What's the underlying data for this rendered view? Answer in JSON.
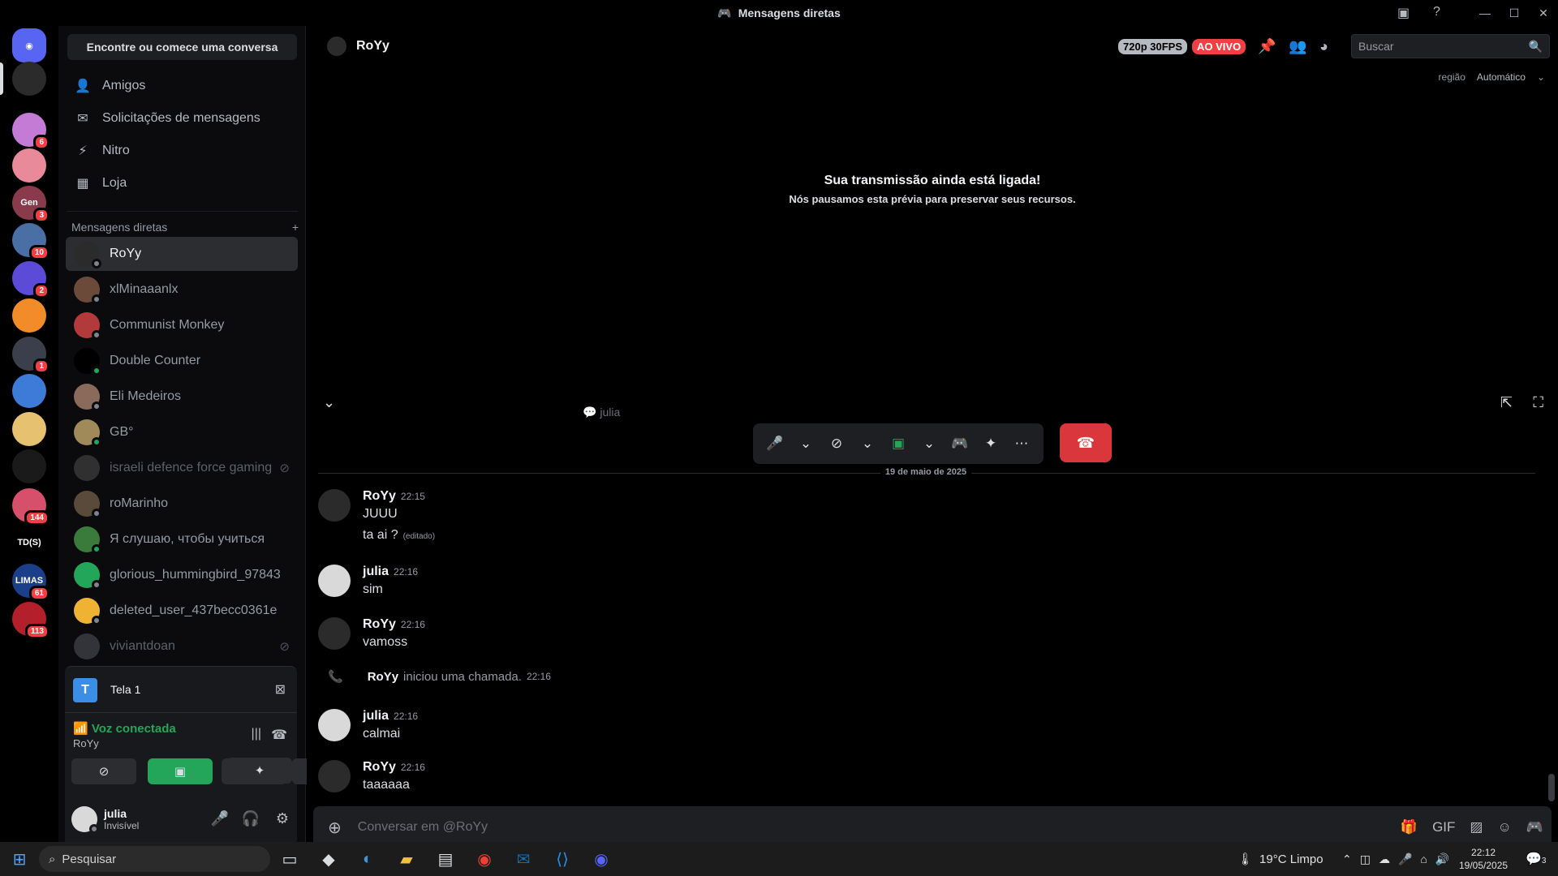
{
  "window": {
    "title": "Mensagens diretas"
  },
  "servers": [
    {
      "label": "",
      "badge": "6",
      "color": "#c47bd6"
    },
    {
      "label": "",
      "badge": "",
      "color": "#e88a9a"
    },
    {
      "label": "Gen",
      "badge": "3",
      "color": "#8a3b4b"
    },
    {
      "label": "",
      "badge": "10",
      "color": "#4a6fa5"
    },
    {
      "label": "",
      "badge": "2",
      "color": "#5b4bd6"
    },
    {
      "label": "",
      "badge": "",
      "color": "#f28c28"
    },
    {
      "label": "",
      "badge": "1",
      "color": "#3a3f4b"
    },
    {
      "label": "",
      "badge": "",
      "color": "#3d7bd9"
    },
    {
      "label": "",
      "badge": "",
      "color": "#e6c170"
    },
    {
      "label": "",
      "badge": "",
      "color": "#1a1a1a"
    },
    {
      "label": "",
      "badge": "144",
      "color": "#d64f6b"
    },
    {
      "label": "TD(S)",
      "badge": "",
      "color": "#000000"
    },
    {
      "label": "LIMAS",
      "badge": "61",
      "color": "#1c3f8a"
    },
    {
      "label": "",
      "badge": "113",
      "color": "#b3202b"
    }
  ],
  "sidebar": {
    "find_label": "Encontre ou comece uma conversa",
    "nav": [
      {
        "label": "Amigos"
      },
      {
        "label": "Solicitações de mensagens"
      },
      {
        "label": "Nitro"
      },
      {
        "label": "Loja"
      }
    ],
    "dm_header": "Mensagens diretas",
    "dms": [
      {
        "name": "RoYy",
        "color": "#2b2b2b"
      },
      {
        "name": "xlMinaaanlx",
        "color": "#6b4a3a"
      },
      {
        "name": "Communist Monkey",
        "color": "#b33a3a"
      },
      {
        "name": "Double Counter",
        "color": "#000000"
      },
      {
        "name": "Eli Medeiros",
        "color": "#8a6a5a"
      },
      {
        "name": "GB°",
        "color": "#a08a5a"
      },
      {
        "name": "israeli defence force gaming",
        "color": "#4a4a4a"
      },
      {
        "name": "roMarinho",
        "color": "#5a4a3a"
      },
      {
        "name": "Я слушаю, чтобы учиться",
        "color": "#3a7a3a"
      },
      {
        "name": "glorious_hummingbird_97843",
        "color": "#23a55a"
      },
      {
        "name": "deleted_user_437becc0361e",
        "color": "#f0b232"
      },
      {
        "name": "viviantdoan",
        "color": "#4e5058"
      }
    ]
  },
  "voice": {
    "stream_label": "Tela 1",
    "status": "Voz conectada",
    "channel": "RoYy"
  },
  "user": {
    "name": "julia",
    "status": "Invisível"
  },
  "header": {
    "name": "RoYy",
    "quality": "720p 30FPS",
    "live": "AO VIVO",
    "search_placeholder": "Buscar",
    "region_label": "região",
    "region_value": "Automático"
  },
  "stage": {
    "title": "Sua transmissão ainda está ligada!",
    "subtitle": "Nós pausamos esta prévia para preservar seus recursos.",
    "participant": "julia"
  },
  "date_divider": "19 de maio de 2025",
  "messages": [
    {
      "author": "RoYy",
      "time": "22:15",
      "lines": [
        "JUUU",
        "ta ai ?"
      ],
      "edited": "(editado)",
      "color": "#2b2b2b"
    },
    {
      "author": "julia",
      "time": "22:16",
      "lines": [
        "sim"
      ],
      "edited": "",
      "color": "#d9d9d9"
    },
    {
      "author": "RoYy",
      "time": "22:16",
      "lines": [
        "vamoss"
      ],
      "edited": "",
      "color": "#2b2b2b"
    },
    {
      "author": "julia",
      "time": "22:16",
      "lines": [
        "calmai"
      ],
      "edited": "",
      "color": "#d9d9d9"
    },
    {
      "author": "RoYy",
      "time": "22:16",
      "lines": [
        "taaaaaa"
      ],
      "edited": "",
      "color": "#2b2b2b"
    }
  ],
  "call_event": {
    "author": "RoYy",
    "text": "iniciou uma chamada.",
    "time": "22:16"
  },
  "composer": {
    "placeholder": "Conversar em @RoYy"
  },
  "taskbar": {
    "search": "Pesquisar",
    "weather": "19°C  Limpo",
    "time": "22:12",
    "date": "19/05/2025",
    "notif": "3"
  }
}
